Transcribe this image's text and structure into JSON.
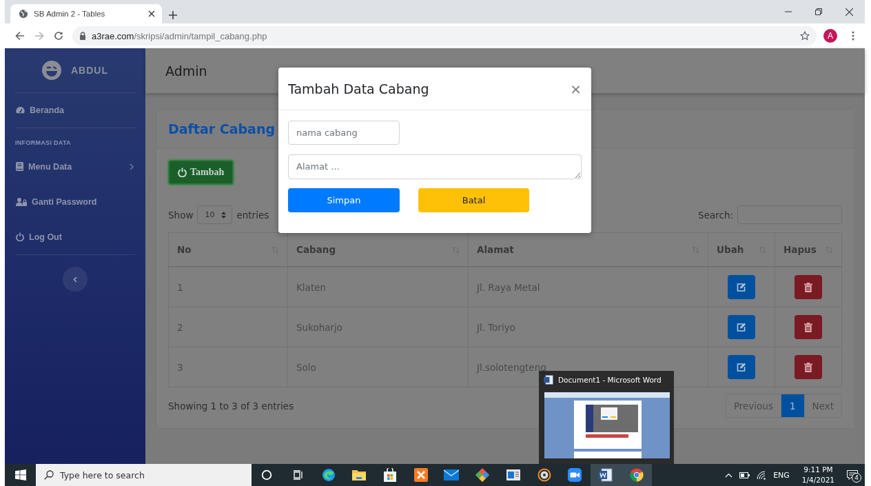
{
  "browser": {
    "tab": {
      "title": "SB Admin 2 - Tables"
    },
    "url": {
      "host": "a3rae.com",
      "path": "/skripsi/admin/tampil_cabang.php"
    },
    "profile_initial": "A"
  },
  "sidebar": {
    "brand": "ABDUL",
    "items": [
      {
        "kind": "home",
        "label": "Beranda"
      },
      {
        "kind": "heading",
        "label": "INFORMASI DATA"
      },
      {
        "kind": "menu",
        "label": "Menu Data",
        "expanded": false
      },
      {
        "kind": "account",
        "label": "Ganti Password"
      },
      {
        "kind": "logout",
        "label": "Log Out"
      }
    ]
  },
  "topbar": {
    "title": "Admin"
  },
  "card": {
    "title": "Daftar Cabang",
    "add_button": "Tambah",
    "length": {
      "before": "Show",
      "value": "10",
      "after": "entries"
    },
    "search": {
      "label": "Search:"
    },
    "table": {
      "columns": [
        "No",
        "Cabang",
        "Alamat",
        "Ubah",
        "Hapus"
      ],
      "rows": [
        {
          "no": "1",
          "cabang": "Klaten",
          "alamat": "Jl. Raya Metal"
        },
        {
          "no": "2",
          "cabang": "Sukoharjo",
          "alamat": "Jl. Toriyo"
        },
        {
          "no": "3",
          "cabang": "Solo",
          "alamat": "Jl.solotengteng"
        }
      ]
    },
    "info": "Showing 1 to 3 of 3 entries",
    "pagination": [
      {
        "label": "Previous",
        "selected": false
      },
      {
        "label": "1",
        "selected": true
      },
      {
        "label": "Next",
        "selected": false
      }
    ]
  },
  "modal": {
    "title": "Tambah Data Cabang",
    "close": "×",
    "fields": [
      {
        "kind": "input",
        "placeholder": "nama cabang"
      },
      {
        "kind": "textarea",
        "placeholder": "Alamat ..."
      }
    ],
    "buttons": [
      {
        "kind": "primary",
        "label": "Simpan"
      },
      {
        "kind": "warning",
        "label": "Batal"
      }
    ]
  },
  "taskbar": {
    "search_placeholder": "Type here to search",
    "apps": [
      {
        "kind": "cortana",
        "active": false
      },
      {
        "kind": "taskview",
        "active": false
      },
      {
        "kind": "edge",
        "active": false
      },
      {
        "kind": "folder",
        "active": false
      },
      {
        "kind": "store",
        "active": false
      },
      {
        "kind": "xampp",
        "active": false
      },
      {
        "kind": "mail",
        "active": false
      },
      {
        "kind": "git",
        "active": false
      },
      {
        "kind": "window",
        "active": false
      },
      {
        "kind": "disc",
        "active": false
      },
      {
        "kind": "camera",
        "active": false
      },
      {
        "kind": "word",
        "active": true
      },
      {
        "kind": "chrome",
        "active": true
      }
    ],
    "tray": {
      "language": "ENG",
      "time": "9:11 PM",
      "date": "1/4/2021",
      "notifications": "4"
    }
  },
  "preview": {
    "title": "Document1 - Microsoft Word"
  }
}
